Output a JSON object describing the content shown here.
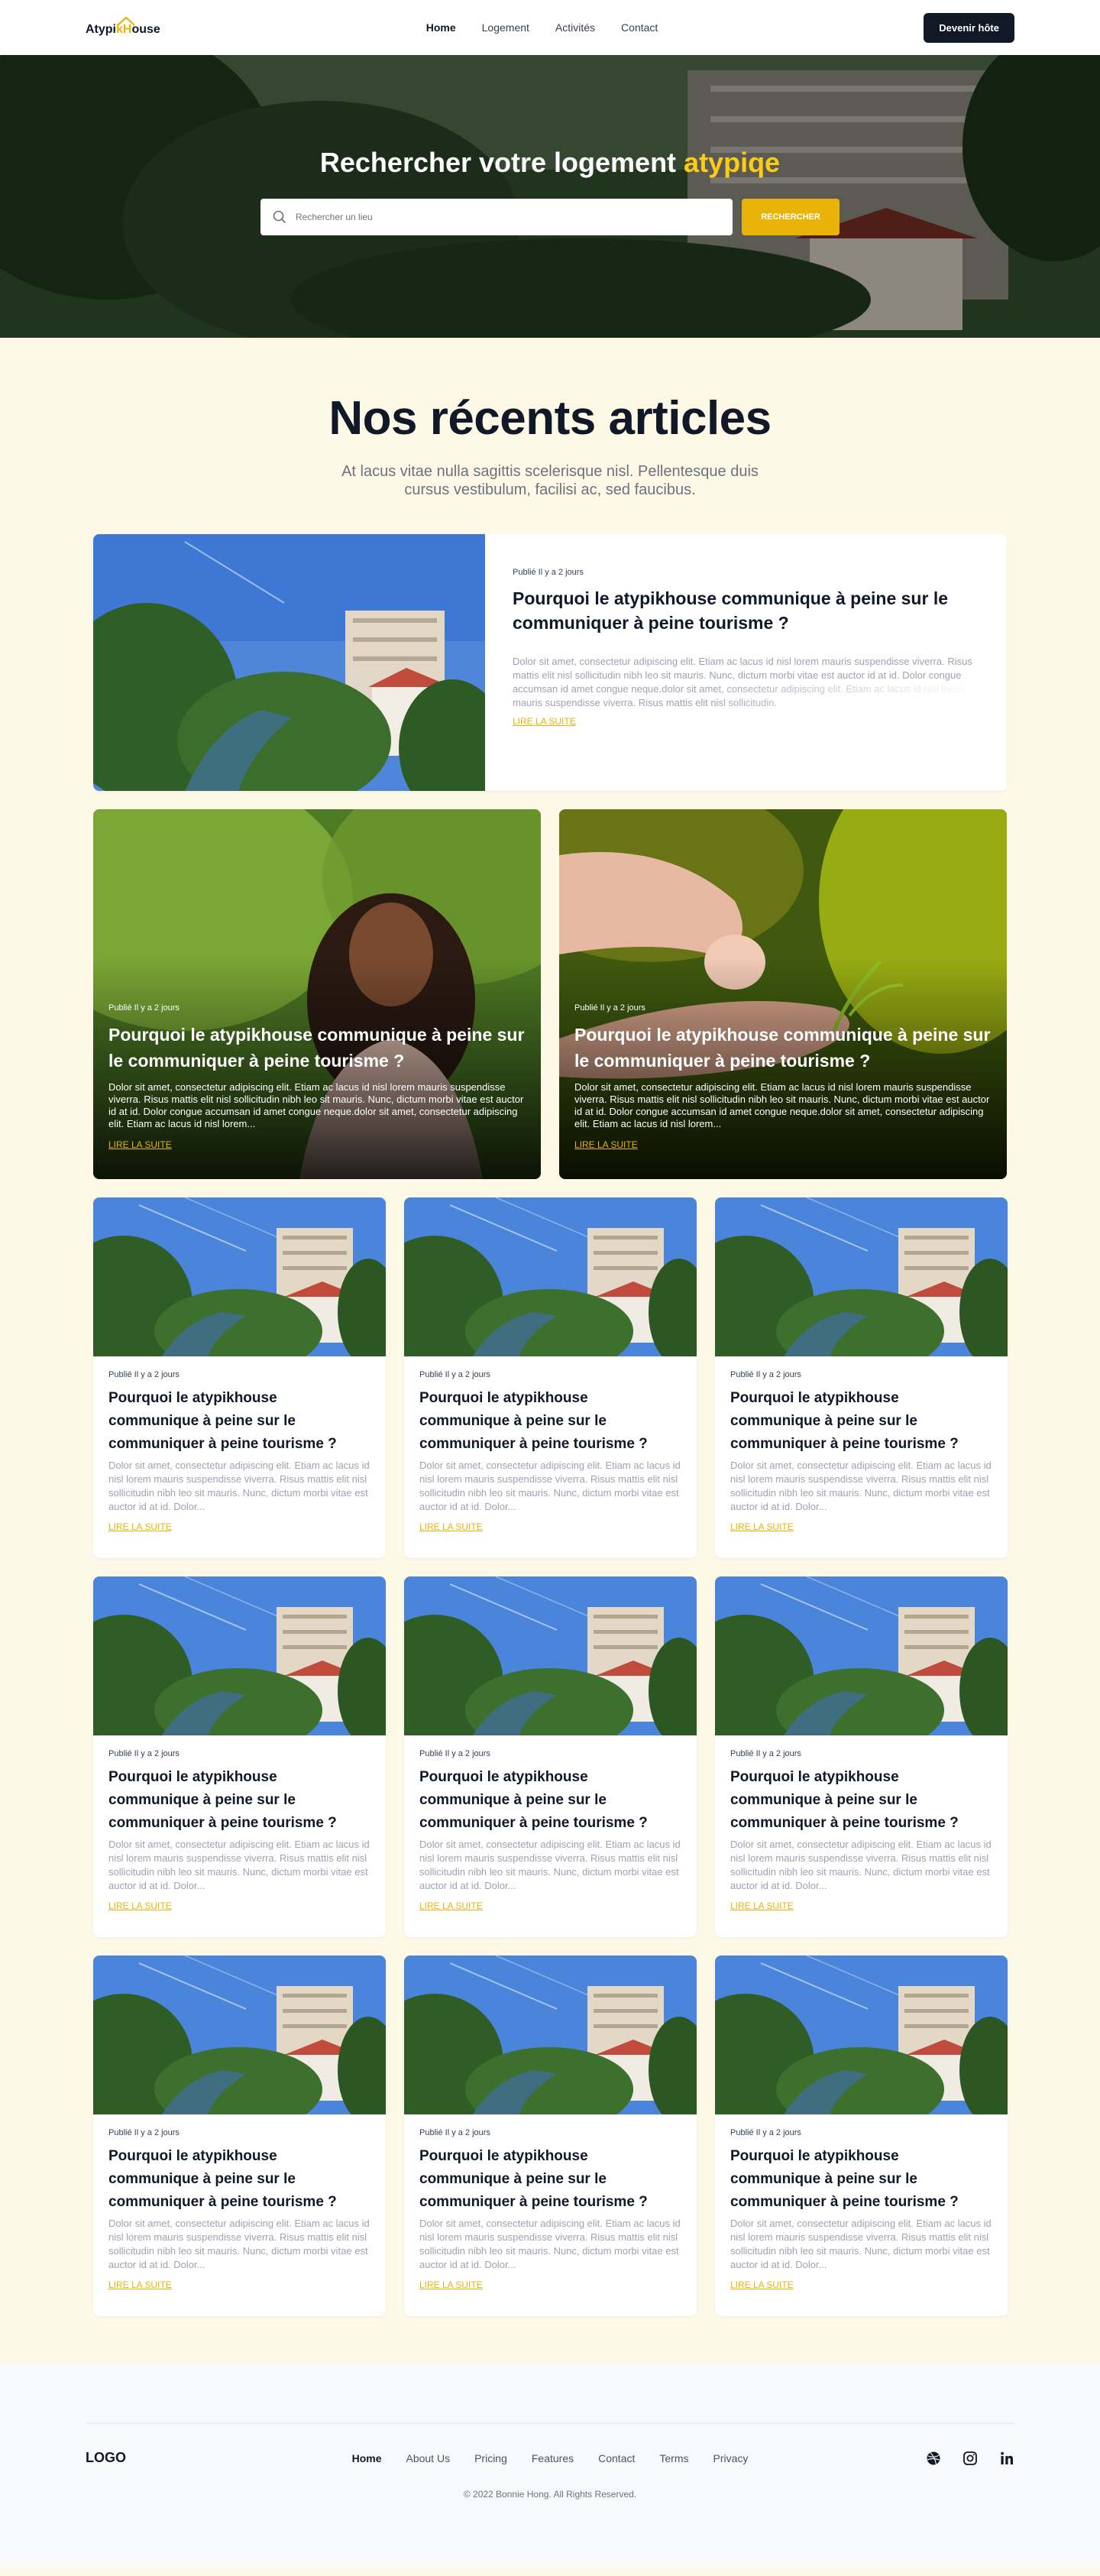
{
  "nav": {
    "logo_left": "Atypi",
    "logo_accent": "kH",
    "logo_right": "ouse",
    "links": [
      {
        "label": "Home"
      },
      {
        "label": "Logement"
      },
      {
        "label": "Activités"
      },
      {
        "label": "Contact"
      }
    ],
    "cta_label": "Devenir hôte"
  },
  "hero": {
    "title_main": "Rechercher votre logement ",
    "title_accent": "atypiqe",
    "search_placeholder": "Rechercher un lieu",
    "search_button": "RECHERCHER"
  },
  "articles": {
    "heading": "Nos récents articles",
    "subheading": "At lacus vitae nulla sagittis scelerisque nisl. Pellentesque duis cursus vestibulum, facilisi ac, sed faucibus.",
    "featured": {
      "meta": "Publié Il y a 2 jours",
      "title": "Pourquoi le atypikhouse communique à peine sur le communiquer à peine tourisme ?",
      "excerpt": "Dolor sit amet, consectetur adipiscing elit. Etiam ac lacus id nisl lorem mauris suspendisse viverra. Risus mattis elit nisl sollicitudin nibh leo sit mauris. Nunc, dictum morbi vitae est auctor id at id. Dolor congue accumsan id amet congue neque.dolor sit amet, consectetur adipiscing elit. Etiam ac lacus id nisl lorem mauris suspendisse viverra. Risus mattis elit nisl sollicitudin.",
      "read_more": "LIRE LA SUITE"
    },
    "duo": [
      {
        "meta": "Publié Il y a 2 jours",
        "title": "Pourquoi le atypikhouse communique à peine sur le  communiquer à peine tourisme ?",
        "excerpt": "Dolor sit amet, consectetur adipiscing elit. Etiam ac lacus id nisl lorem mauris suspendisse viverra. Risus mattis elit nisl sollicitudin nibh leo sit mauris. Nunc, dictum morbi vitae est auctor id at id. Dolor congue accumsan id amet congue neque.dolor sit amet, consectetur adipiscing elit. Etiam ac lacus id nisl lorem...",
        "read_more": "LIRE LA SUITE"
      },
      {
        "meta": "Publié Il y a 2 jours",
        "title": "Pourquoi le atypikhouse communique à peine sur le  communiquer à peine tourisme ?",
        "excerpt": "Dolor sit amet, consectetur adipiscing elit. Etiam ac lacus id nisl lorem mauris suspendisse viverra. Risus mattis elit nisl sollicitudin nibh leo sit mauris. Nunc, dictum morbi vitae est auctor id at id. Dolor congue accumsan id amet congue neque.dolor sit amet, consectetur adipiscing elit. Etiam ac lacus id nisl lorem...",
        "read_more": "LIRE LA SUITE"
      }
    ],
    "cards": [
      {
        "meta": "Publié Il y a 2 jours",
        "title": "Pourquoi le atypikhouse communique à peine sur le communiquer à peine tourisme ?",
        "excerpt": "Dolor sit amet, consectetur adipiscing elit. Etiam ac lacus id nisl lorem mauris suspendisse viverra. Risus mattis elit nisl sollicitudin nibh leo sit mauris. Nunc, dictum morbi vitae est auctor id at id. Dolor...",
        "read_more": "LIRE LA SUITE"
      },
      {
        "meta": "Publié Il y a 2 jours",
        "title": "Pourquoi le atypikhouse communique à peine sur le communiquer à peine tourisme ?",
        "excerpt": "Dolor sit amet, consectetur adipiscing elit. Etiam ac lacus id nisl lorem mauris suspendisse viverra. Risus mattis elit nisl sollicitudin nibh leo sit mauris. Nunc, dictum morbi vitae est auctor id at id. Dolor...",
        "read_more": "LIRE LA SUITE"
      },
      {
        "meta": "Publié Il y a 2 jours",
        "title": "Pourquoi le atypikhouse communique à peine sur le communiquer à peine tourisme ?",
        "excerpt": "Dolor sit amet, consectetur adipiscing elit. Etiam ac lacus id nisl lorem mauris suspendisse viverra. Risus mattis elit nisl sollicitudin nibh leo sit mauris. Nunc, dictum morbi vitae est auctor id at id. Dolor...",
        "read_more": "LIRE LA SUITE"
      },
      {
        "meta": "Publié Il y a 2 jours",
        "title": "Pourquoi le atypikhouse communique à peine sur le communiquer à peine tourisme ?",
        "excerpt": "Dolor sit amet, consectetur adipiscing elit. Etiam ac lacus id nisl lorem mauris suspendisse viverra. Risus mattis elit nisl sollicitudin nibh leo sit mauris. Nunc, dictum morbi vitae est auctor id at id. Dolor...",
        "read_more": "LIRE LA SUITE"
      },
      {
        "meta": "Publié Il y a 2 jours",
        "title": "Pourquoi le atypikhouse communique à peine sur le communiquer à peine tourisme ?",
        "excerpt": "Dolor sit amet, consectetur adipiscing elit. Etiam ac lacus id nisl lorem mauris suspendisse viverra. Risus mattis elit nisl sollicitudin nibh leo sit mauris. Nunc, dictum morbi vitae est auctor id at id. Dolor...",
        "read_more": "LIRE LA SUITE"
      },
      {
        "meta": "Publié Il y a 2 jours",
        "title": "Pourquoi le atypikhouse communique à peine sur le communiquer à peine tourisme ?",
        "excerpt": "Dolor sit amet, consectetur adipiscing elit. Etiam ac lacus id nisl lorem mauris suspendisse viverra. Risus mattis elit nisl sollicitudin nibh leo sit mauris. Nunc, dictum morbi vitae est auctor id at id. Dolor...",
        "read_more": "LIRE LA SUITE"
      },
      {
        "meta": "Publié Il y a 2 jours",
        "title": "Pourquoi le atypikhouse communique à peine sur le communiquer à peine tourisme ?",
        "excerpt": "Dolor sit amet, consectetur adipiscing elit. Etiam ac lacus id nisl lorem mauris suspendisse viverra. Risus mattis elit nisl sollicitudin nibh leo sit mauris. Nunc, dictum morbi vitae est auctor id at id. Dolor...",
        "read_more": "LIRE LA SUITE"
      },
      {
        "meta": "Publié Il y a 2 jours",
        "title": "Pourquoi le atypikhouse communique à peine sur le communiquer à peine tourisme ?",
        "excerpt": "Dolor sit amet, consectetur adipiscing elit. Etiam ac lacus id nisl lorem mauris suspendisse viverra. Risus mattis elit nisl sollicitudin nibh leo sit mauris. Nunc, dictum morbi vitae est auctor id at id. Dolor...",
        "read_more": "LIRE LA SUITE"
      },
      {
        "meta": "Publié Il y a 2 jours",
        "title": "Pourquoi le atypikhouse communique à peine sur le communiquer à peine tourisme ?",
        "excerpt": "Dolor sit amet, consectetur adipiscing elit. Etiam ac lacus id nisl lorem mauris suspendisse viverra. Risus mattis elit nisl sollicitudin nibh leo sit mauris. Nunc, dictum morbi vitae est auctor id at id. Dolor...",
        "read_more": "LIRE LA SUITE"
      }
    ]
  },
  "footer": {
    "logo": "LOGO",
    "links": [
      {
        "label": "Home"
      },
      {
        "label": "About Us"
      },
      {
        "label": "Pricing"
      },
      {
        "label": "Features"
      },
      {
        "label": "Contact"
      },
      {
        "label": "Terms"
      },
      {
        "label": "Privacy"
      }
    ],
    "socials": [
      "dribbble-icon",
      "instagram-icon",
      "linkedin-icon"
    ],
    "copyright": "© 2022 Bonnie Hong. All Rights Reserved."
  },
  "colors": {
    "accent": "#eab308",
    "dark": "#111827",
    "page_bg": "#fdf9e6",
    "footer_bg": "#f8f9fb"
  }
}
